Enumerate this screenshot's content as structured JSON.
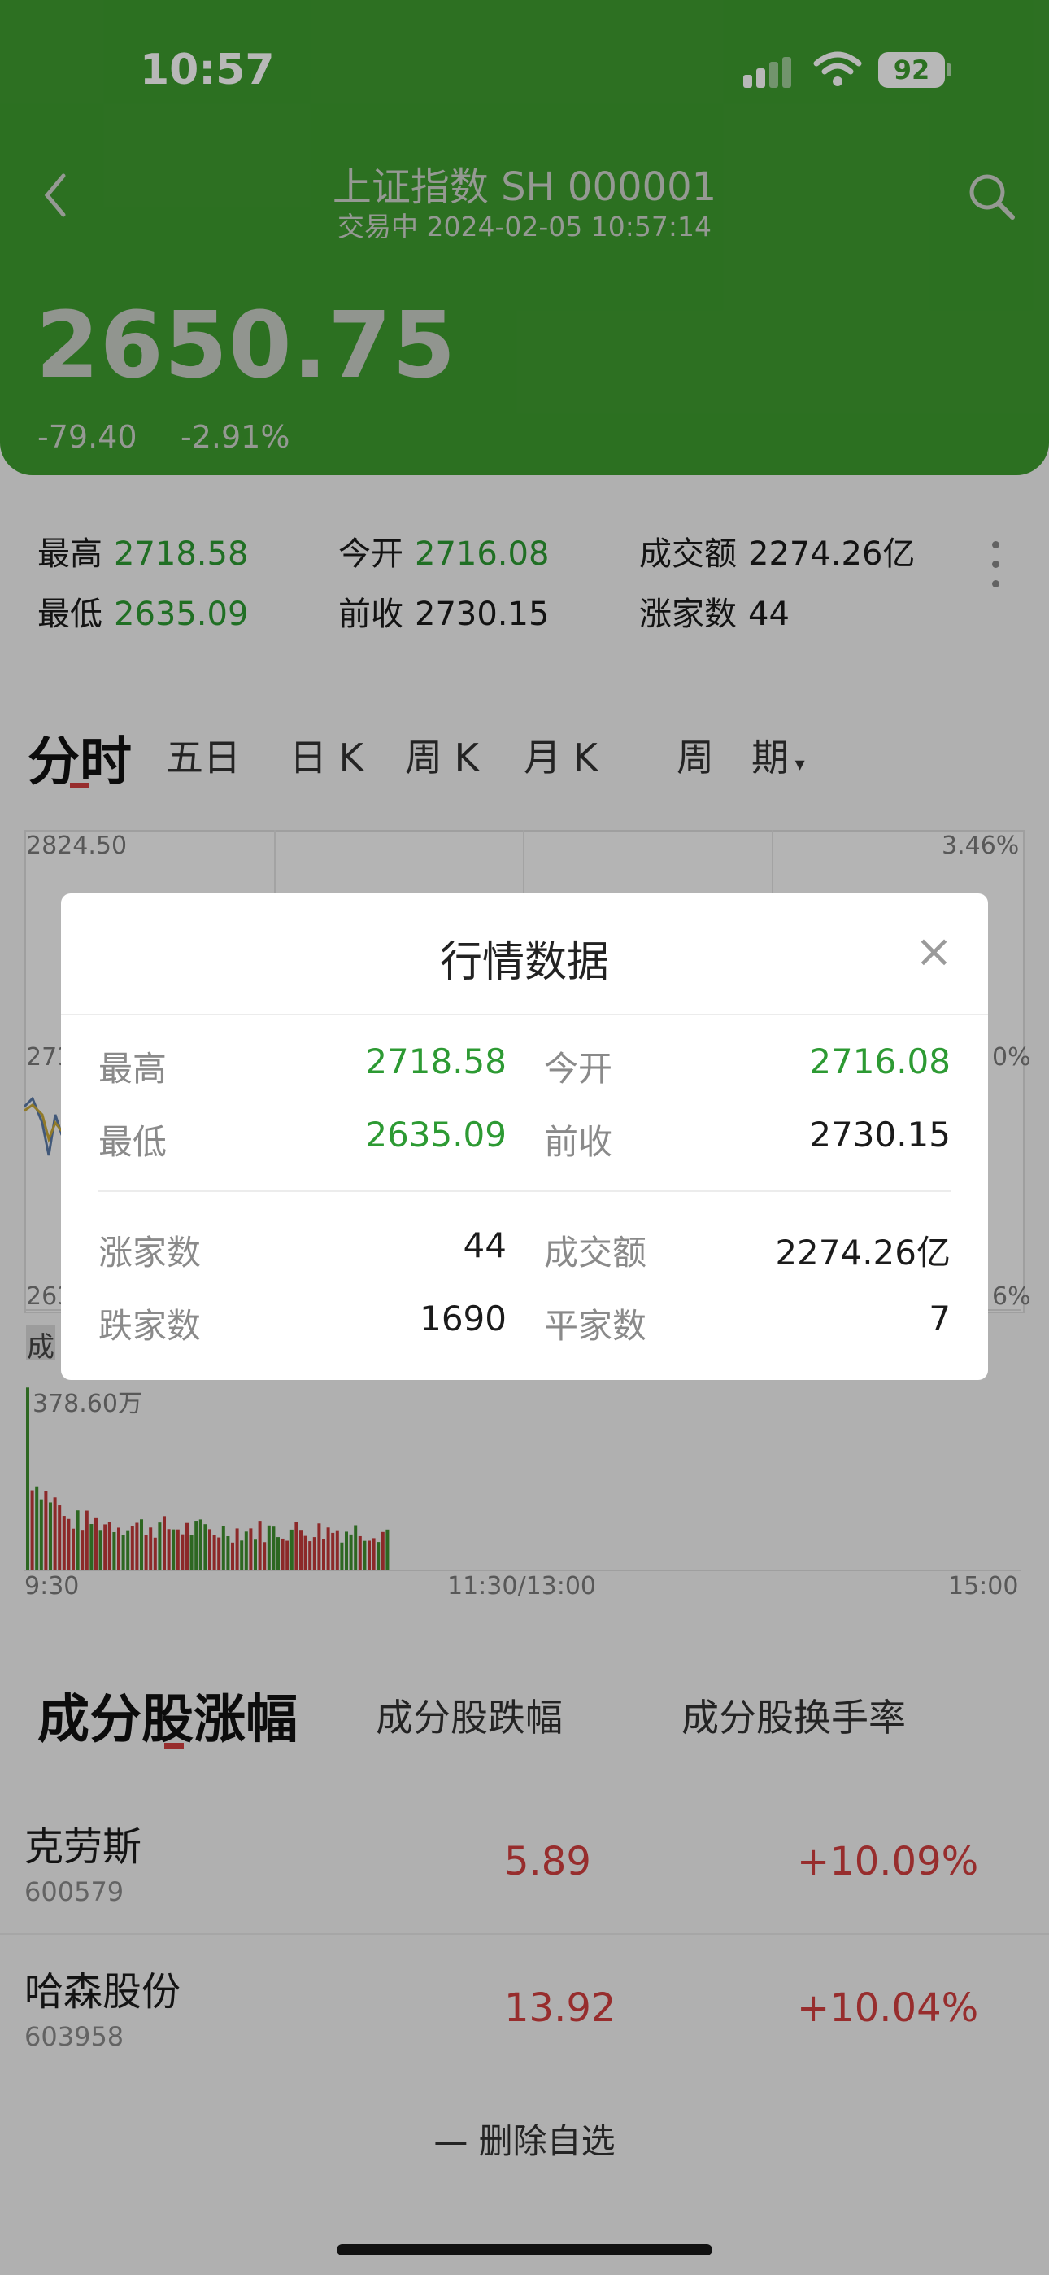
{
  "status_bar": {
    "time": "10:57",
    "battery": "92"
  },
  "header": {
    "title": "上证指数 SH 000001",
    "subtitle": "交易中 2024-02-05 10:57:14",
    "price": "2650.75",
    "change": "-79.40",
    "change_pct": "-2.91%"
  },
  "stats": {
    "high_label": "最高",
    "high": "2718.58",
    "low_label": "最低",
    "low": "2635.09",
    "open_label": "今开",
    "open": "2716.08",
    "prev_label": "前收",
    "prev": "2730.15",
    "turnover_label": "成交额",
    "turnover": "2274.26亿",
    "up_label": "涨家数",
    "up": "44"
  },
  "tabs": {
    "fenshi": "分时",
    "wuri": "五日",
    "rik": "日 K",
    "zhouk": "周 K",
    "yuek": "月 K",
    "zhouqi": "周　期"
  },
  "chart": {
    "y_top": "2824.50",
    "y_top_pct": "3.46%",
    "y_mid_partial": "273",
    "y_mid_pct_partial": "0%",
    "y_low_partial": "263",
    "y_low_pct_partial": "6%",
    "vol_tag": "成",
    "vol_max": "378.60万",
    "x_start": "9:30",
    "x_mid": "11:30/13:00",
    "x_end": "15:00"
  },
  "modal": {
    "title": "行情数据",
    "close": "×",
    "high_label": "最高",
    "high": "2718.58",
    "open_label": "今开",
    "open": "2716.08",
    "low_label": "最低",
    "low": "2635.09",
    "prev_label": "前收",
    "prev": "2730.15",
    "up_label": "涨家数",
    "up": "44",
    "turnover_label": "成交额",
    "turnover": "2274.26亿",
    "down_label": "跌家数",
    "down": "1690",
    "flat_label": "平家数",
    "flat": "7"
  },
  "constituents": {
    "tabs": [
      "成分股涨幅",
      "成分股跌幅",
      "成分股换手率"
    ],
    "rows": [
      {
        "name": "克劳斯",
        "code": "600579",
        "price": "5.89",
        "pct": "+10.09%"
      },
      {
        "name": "哈森股份",
        "code": "603958",
        "price": "13.92",
        "pct": "+10.04%"
      }
    ]
  },
  "bottom": {
    "remove_label": "— 删除自选"
  },
  "colors": {
    "header_green": "#3e9b2f",
    "up_red": "#d23f3f",
    "down_green": "#2d9a33"
  }
}
